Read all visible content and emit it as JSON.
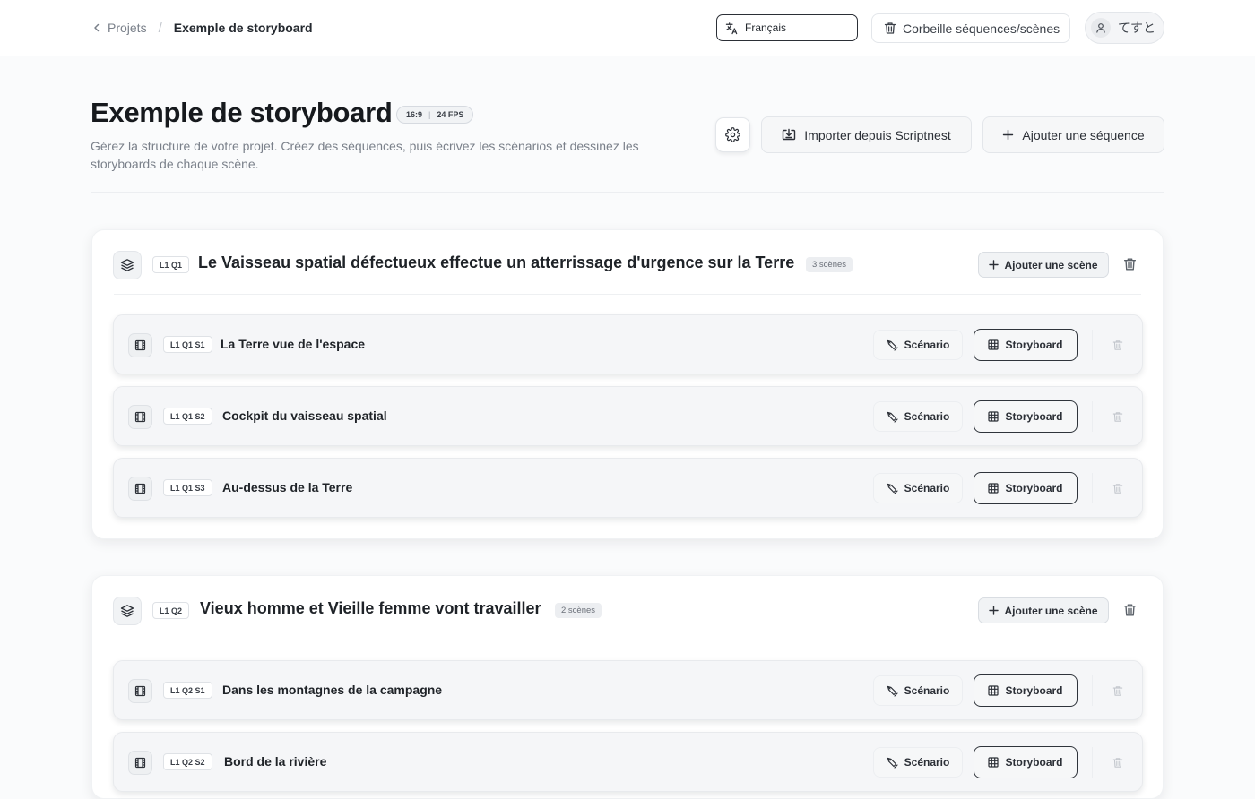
{
  "header": {
    "breadcrumb_parent": "Projets",
    "breadcrumb_separator": "/",
    "breadcrumb_current": "Exemple de storyboard",
    "language": "Français",
    "trash_label": "Corbeille séquences/scènes",
    "user_name": "てすと"
  },
  "project": {
    "title": "Exemple de storyboard",
    "aspect_ratio": "16:9",
    "fps": "24 FPS",
    "description": "Gérez la structure de votre projet. Créez des séquences, puis écrivez les scénarios et dessinez les storyboards de chaque scène.",
    "import_label": "Importer depuis Scriptnest",
    "add_sequence_label": "Ajouter une séquence"
  },
  "labels": {
    "add_scene": "Ajouter une scène",
    "scenario": "Scénario",
    "storyboard": "Storyboard"
  },
  "sequences": [
    {
      "code": "L1 Q1",
      "title": "Le Vaisseau spatial défectueux effectue un atterrissage d'urgence sur la Terre",
      "count": "3 scènes",
      "scenes": [
        {
          "code": "L1 Q1 S1",
          "title": "La Terre vue de l'espace"
        },
        {
          "code": "L1 Q1 S2",
          "title": "Cockpit du vaisseau spatial"
        },
        {
          "code": "L1 Q1 S3",
          "title": "Au-dessus de la Terre"
        }
      ]
    },
    {
      "code": "L1 Q2",
      "title": "Vieux homme et Vieille femme vont travailler",
      "count": "2 scènes",
      "scenes": [
        {
          "code": "L1 Q2 S1",
          "title": "Dans les montagnes de la campagne"
        },
        {
          "code": "L1 Q2 S2",
          "title": "Bord de la rivière"
        }
      ]
    }
  ],
  "icons": {
    "back": "chevron-left-icon",
    "language": "translate-icon",
    "trash": "trash-icon",
    "user": "user-icon",
    "settings": "gear-icon",
    "import": "import-icon",
    "plus": "plus-icon",
    "sequence": "layers-icon",
    "scene": "film-icon",
    "scenario": "pen-icon",
    "storyboard": "grid-icon"
  }
}
